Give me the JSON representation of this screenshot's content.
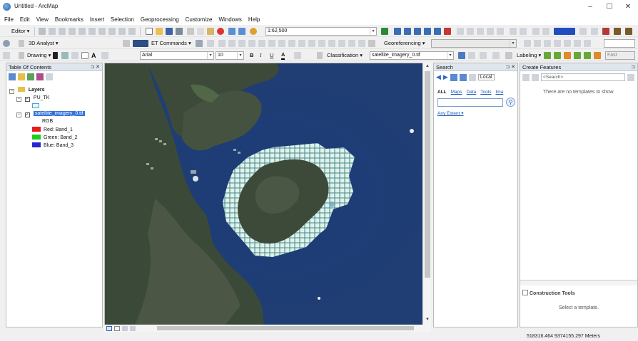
{
  "window": {
    "title": "Untitled - ArcMap",
    "minimize": "–",
    "maximize": "☐",
    "close": "✕"
  },
  "menu": [
    "File",
    "Edit",
    "View",
    "Bookmarks",
    "Insert",
    "Selection",
    "Geoprocessing",
    "Customize",
    "Windows",
    "Help"
  ],
  "toolbar1": {
    "editor": "Editor ▾",
    "scale": "1:62,500"
  },
  "toolbar2": {
    "analyst": "3D Analyst ▾",
    "et_commands": "ET Commands ▾",
    "georeferencing": "Georeferencing ▾"
  },
  "toolbar3": {
    "drawing": "Drawing ▾",
    "font": "Arial",
    "font_size": "10",
    "bold": "B",
    "italic": "I",
    "underline": "U",
    "classification": "Classification ▾",
    "layer": "satellite_imagery_0.tif",
    "labeling": "Labeling ▾",
    "fast": "Fast"
  },
  "toc": {
    "title": "Table Of Contents",
    "root": "Layers",
    "layers": [
      {
        "name": "PU_TK"
      },
      {
        "name": "satellite_imagery_0.tif",
        "sublabel": "RGB",
        "bands": [
          {
            "label": "Red:  Band_1",
            "color": "#e81c1c"
          },
          {
            "label": "Green: Band_2",
            "color": "#1fcc1f"
          },
          {
            "label": "Blue:  Band_3",
            "color": "#2424d8"
          }
        ]
      }
    ]
  },
  "search": {
    "title": "Search",
    "location": "Local",
    "tabs": [
      "ALL",
      "Maps",
      "Data",
      "Tools",
      "Ima"
    ],
    "extent": "Any Extent ▾"
  },
  "create_features": {
    "title": "Create Features",
    "search_placeholder": "<Search>",
    "empty_msg": "There are no templates to show.",
    "construction_title": "Construction Tools",
    "construction_msg": "Select a template."
  },
  "status": {
    "coords": "518316.464  9374155.297 Meters"
  },
  "colors": {
    "water": "#1f3f78",
    "land": "#3e4a38",
    "grid": "#d6efe6",
    "panel_head": "#dfe6ee"
  }
}
